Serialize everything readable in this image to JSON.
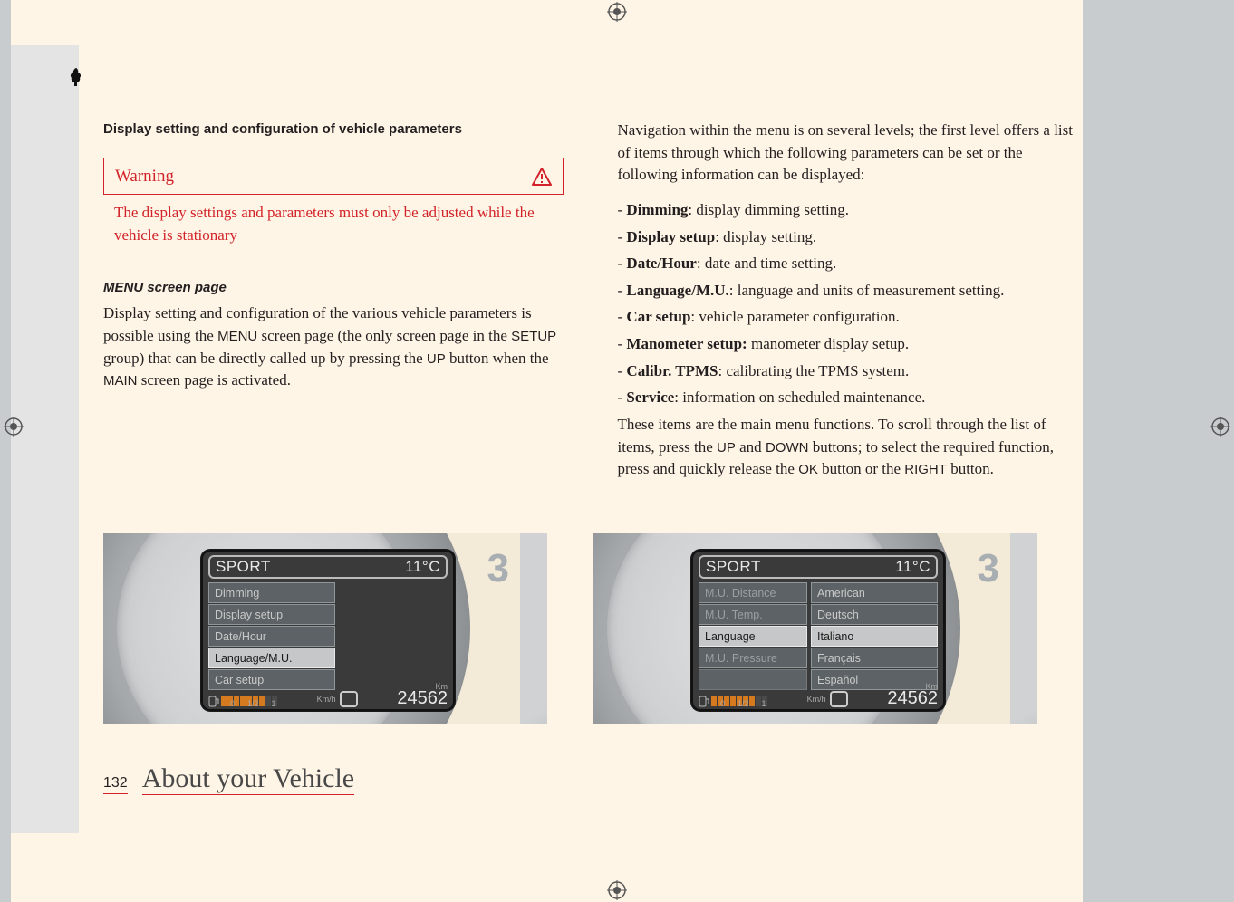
{
  "page": {
    "number": "132",
    "footer_title": "About your Vehicle"
  },
  "col1": {
    "title": "Display setting and configuration of vehicle parameters",
    "warning_label": "Warning",
    "warning_text": "The display settings and parameters must only be adjusted while the vehicle is stationary",
    "subhead": "MENU screen page",
    "p1a": "Display setting and configuration of the various vehicle parameters is possible using the ",
    "p1b": " screen page (the only screen page in the ",
    "p1c": " group) that can be directly called up by pressing the ",
    "p1d": " button when the ",
    "p1e": " screen page is activated.",
    "MENU": "MENU",
    "SETUP": "SETUP",
    "UP": "UP",
    "MAIN": "MAIN"
  },
  "col2": {
    "intro": "Navigation within the menu is on several levels; the first level offers a list of items through which the following parameters can be set or the following information can be displayed:",
    "items": [
      {
        "b": "Dimming",
        "t": ": display dimming setting."
      },
      {
        "b": "Display setup",
        "t": ": display setting."
      },
      {
        "b": "Date/Hour",
        "t": ": date and time setting."
      },
      {
        "b": "Language/M.U.",
        "t": ": language and units of measurement setting."
      },
      {
        "b": "Car setup",
        "t": ": vehicle parameter configuration."
      },
      {
        "b": "Manometer setup:",
        "t": " manometer display setup."
      },
      {
        "b": "Calibr. TPMS",
        "t": ": calibrating the TPMS system."
      },
      {
        "b": "Service",
        "t": ": information on scheduled maintenance."
      }
    ],
    "outro_a": "These items are the main menu functions. To scroll through the list of items, press the ",
    "outro_b": " and ",
    "outro_c": " buttons; to select the required function, press and quickly release the ",
    "outro_d": " button or the ",
    "outro_e": " button.",
    "UP": "UP",
    "DOWN": "DOWN",
    "OK": "OK",
    "RIGHT": "RIGHT"
  },
  "dash": {
    "mode": "SPORT",
    "temp": "11°C",
    "kmh_label": "Km/h",
    "km_label": "Km",
    "odometer": "24562",
    "fuel_0": "0",
    "fuel_half": "1/2",
    "fuel_1": "1",
    "big3": "3",
    "left_menu": [
      "Dimming",
      "Display setup",
      "Date/Hour",
      "Language/M.U.",
      "Car setup"
    ],
    "left_highlight": 3,
    "right_left": [
      "M.U. Distance",
      "M.U. Temp.",
      "Language",
      "M.U. Pressure",
      ""
    ],
    "right_left_highlight": 2,
    "right_right": [
      "American",
      "Deutsch",
      "Italiano",
      "Français",
      "Español"
    ],
    "right_right_highlight": 2
  }
}
